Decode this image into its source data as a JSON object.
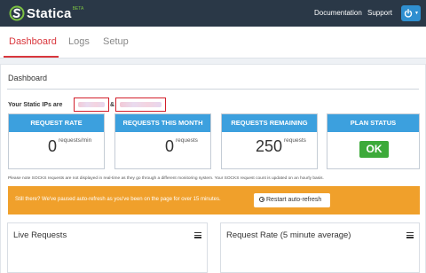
{
  "header": {
    "brand": "Statica",
    "brand_tag": "BETA",
    "links": [
      "Documentation",
      "Support"
    ]
  },
  "tabs": [
    {
      "label": "Dashboard",
      "active": true
    },
    {
      "label": "Logs",
      "active": false
    },
    {
      "label": "Setup",
      "active": false
    }
  ],
  "dashboard": {
    "title": "Dashboard",
    "static_ips_label": "Your Static IPs are",
    "ip_separator": "&"
  },
  "cards": [
    {
      "title": "Request Rate",
      "value": "0",
      "unit": "requests/min"
    },
    {
      "title": "Requests This Month",
      "value": "0",
      "unit": "requests"
    },
    {
      "title": "Requests Remaining",
      "value": "250",
      "unit": "requests"
    },
    {
      "title": "Plan Status",
      "badge": "OK"
    }
  ],
  "note": "Please note SOCKS requests are not displayed in real-time as they go through a different monitoring system. Your SOCKS request count is updated on an hourly basis.",
  "alert": {
    "text": "Still there? We've paused auto-refresh as you've been on the page for over 15 minutes.",
    "button": "Restart auto-refresh"
  },
  "panels": [
    {
      "title": "Live Requests"
    },
    {
      "title": "Request Rate (5 minute average)"
    }
  ],
  "colors": {
    "topbar": "#2a3847",
    "accent_red": "#d9373d",
    "card_header": "#3ca0de",
    "ok_green": "#3daa3a",
    "alert_orange": "#f0a02b",
    "power_blue": "#2f8fd0"
  }
}
